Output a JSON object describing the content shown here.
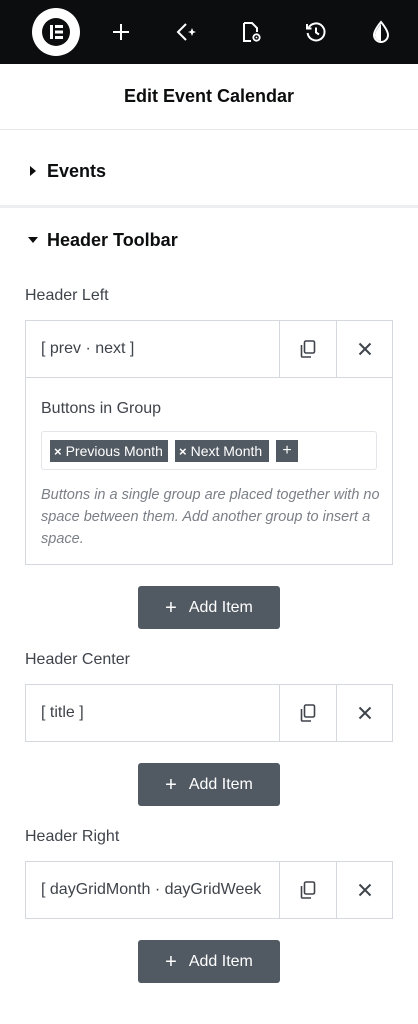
{
  "toolbar": {
    "logo_icon": "elementor-logo-icon",
    "icons": [
      "plus-icon",
      "ai-sparkle-icon",
      "page-settings-icon",
      "history-icon",
      "theme-style-icon"
    ]
  },
  "header": {
    "title": "Edit Event Calendar"
  },
  "sections": {
    "events": {
      "title": "Events"
    },
    "header_toolbar": {
      "title": "Header Toolbar"
    }
  },
  "header_left": {
    "label": "Header Left",
    "item_title": "[ prev · next ]",
    "buttons_label": "Buttons in Group",
    "tags": [
      "Previous Month",
      "Next Month"
    ],
    "tag_remove": "×",
    "tag_add": "+",
    "help": "Buttons in a single group are placed together with no space between them. Add another group to insert a space.",
    "add_label": "Add Item"
  },
  "header_center": {
    "label": "Header Center",
    "item_title": "[ title ]",
    "add_label": "Add Item"
  },
  "header_right": {
    "label": "Header Right",
    "item_title": "[ dayGridMonth · dayGridWeek",
    "add_label": "Add Item"
  },
  "glyphs": {
    "plus": "+"
  },
  "colors": {
    "topbar": "#0c0d0e",
    "button": "#515962",
    "border": "#d5d8dc"
  }
}
